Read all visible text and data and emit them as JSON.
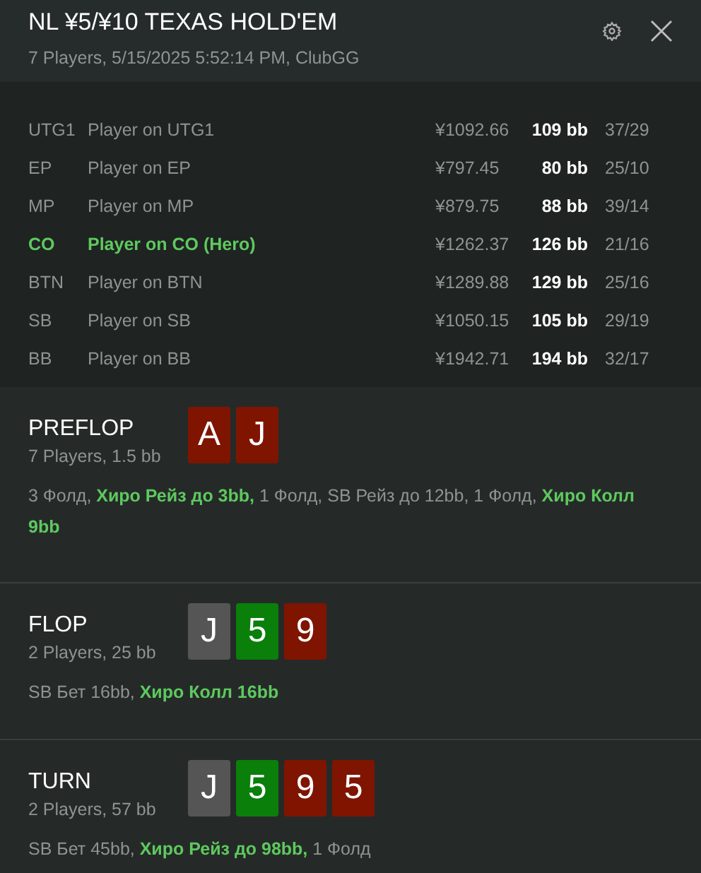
{
  "header": {
    "title": "NL ¥5/¥10 TEXAS HOLD'EM",
    "subtitle": "7 Players, 5/15/2025 5:52:14 PM, ClubGG"
  },
  "players": [
    {
      "position": "UTG1",
      "name": "Player on UTG1",
      "stack": "¥1092.66",
      "bb": "109 bb",
      "stats": "37/29",
      "hero": false
    },
    {
      "position": "EP",
      "name": "Player on EP",
      "stack": "¥797.45",
      "bb": "80 bb",
      "stats": "25/10",
      "hero": false
    },
    {
      "position": "MP",
      "name": "Player on MP",
      "stack": "¥879.75",
      "bb": "88 bb",
      "stats": "39/14",
      "hero": false
    },
    {
      "position": "CO",
      "name": "Player on CO (Hero)",
      "stack": "¥1262.37",
      "bb": "126 bb",
      "stats": "21/16",
      "hero": true
    },
    {
      "position": "BTN",
      "name": "Player on BTN",
      "stack": "¥1289.88",
      "bb": "129 bb",
      "stats": "25/16",
      "hero": false
    },
    {
      "position": "SB",
      "name": "Player on SB",
      "stack": "¥1050.15",
      "bb": "105 bb",
      "stats": "29/19",
      "hero": false
    },
    {
      "position": "BB",
      "name": "Player on BB",
      "stack": "¥1942.71",
      "bb": "194 bb",
      "stats": "32/17",
      "hero": false
    }
  ],
  "streets": [
    {
      "name": "PREFLOP",
      "info": "7 Players, 1.5 bb",
      "cards": [
        {
          "rank": "A",
          "color": "#7f1500"
        },
        {
          "rank": "J",
          "color": "#7f1500"
        }
      ],
      "actions": [
        {
          "text": "3 Фолд, ",
          "hero": false
        },
        {
          "text": "Хиро Рейз до 3bb,",
          "hero": true
        },
        {
          "text": " 1 Фолд, SB Рейз до 12bb, 1 Фолд, ",
          "hero": false
        },
        {
          "text": "Хиро Колл 9bb",
          "hero": true
        }
      ]
    },
    {
      "name": "FLOP",
      "info": "2 Players, 25 bb",
      "cards": [
        {
          "rank": "J",
          "color": "#555555"
        },
        {
          "rank": "5",
          "color": "#0a7f0a"
        },
        {
          "rank": "9",
          "color": "#7f1500"
        }
      ],
      "actions": [
        {
          "text": "SB Бет 16bb, ",
          "hero": false
        },
        {
          "text": "Хиро Колл 16bb",
          "hero": true
        }
      ]
    },
    {
      "name": "TURN",
      "info": "2 Players, 57 bb",
      "cards": [
        {
          "rank": "J",
          "color": "#555555"
        },
        {
          "rank": "5",
          "color": "#0a7f0a"
        },
        {
          "rank": "9",
          "color": "#7f1500"
        },
        {
          "rank": "5",
          "color": "#7f1500"
        }
      ],
      "actions": [
        {
          "text": "SB Бет 45bb, ",
          "hero": false
        },
        {
          "text": "Хиро Рейз до 98bb,",
          "hero": true
        },
        {
          "text": " 1 Фолд",
          "hero": false
        }
      ]
    }
  ]
}
